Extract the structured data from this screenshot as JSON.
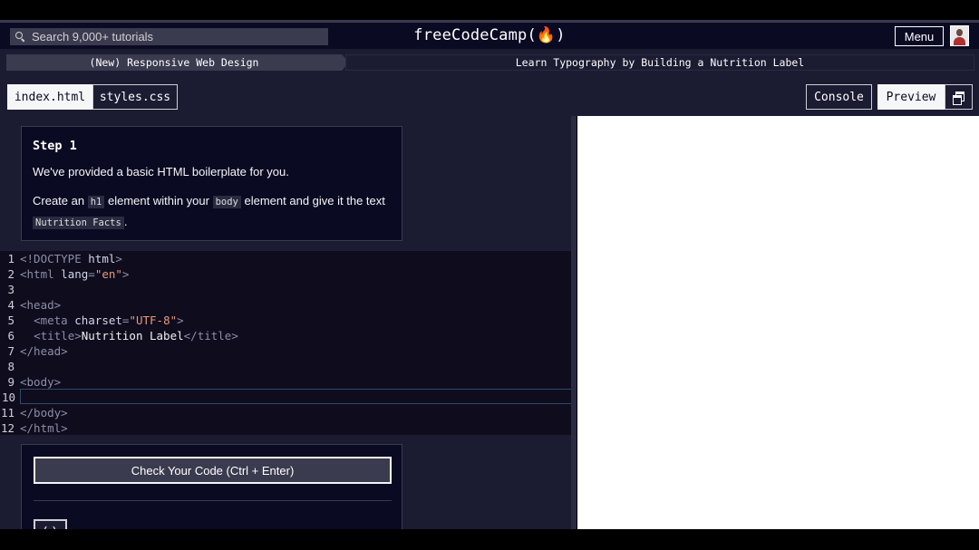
{
  "nav": {
    "search_placeholder": "Search 9,000+ tutorials",
    "brand": "freeCodeCamp(🔥)",
    "menu_label": "Menu"
  },
  "breadcrumb": {
    "superblock": "(New) Responsive Web Design",
    "block": "Learn Typography by Building a Nutrition Label"
  },
  "toolbar": {
    "tabs": [
      "index.html",
      "styles.css"
    ],
    "console_label": "Console",
    "preview_label": "Preview"
  },
  "instructions": {
    "step_title": "Step 1",
    "p1": "We've provided a basic HTML boilerplate for you.",
    "p2_a": "Create an ",
    "p2_code1": "h1",
    "p2_b": " element within your ",
    "p2_code2": "body",
    "p2_c": " element and give it the text",
    "p2_code3": "Nutrition Facts",
    "p2_d": "."
  },
  "editor": {
    "line_numbers": [
      "1",
      "2",
      "3",
      "4",
      "5",
      "6",
      "7",
      "8",
      "9",
      "10",
      "11",
      "12"
    ],
    "active_line": 10
  },
  "actions": {
    "check_label": "Check Your Code (Ctrl + Enter)"
  },
  "colors": {
    "nav_bg": "#0a0a23",
    "panel_bg": "#1b1b32",
    "editor_bg": "#0f0c1e",
    "preview_bg": "#ffffff"
  }
}
